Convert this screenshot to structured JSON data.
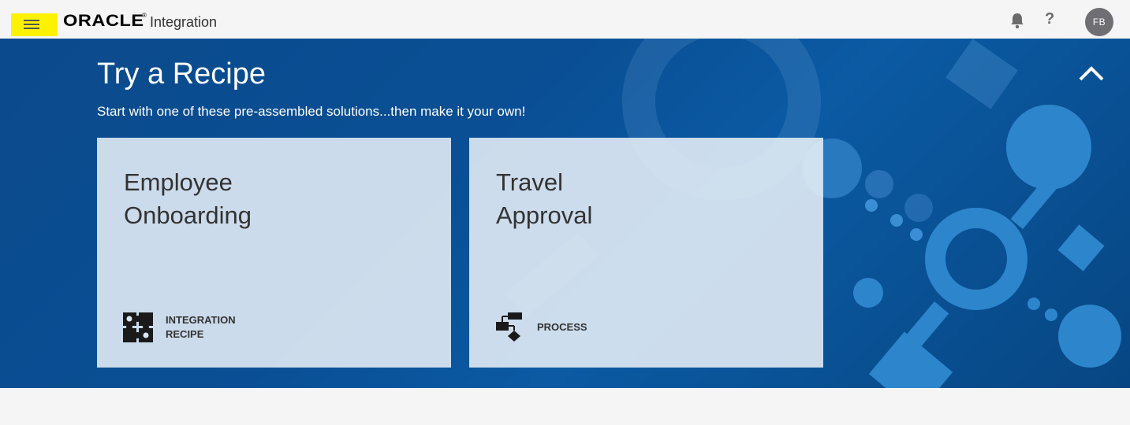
{
  "header": {
    "logo_text": "ORACLE",
    "logo_mark": "®",
    "product_name": "Integration",
    "menu_icon": "hamburger-menu-icon",
    "notifications_icon": "bell-icon",
    "help_icon": "help-icon",
    "help_glyph": "?",
    "user_initials": "FB"
  },
  "hero": {
    "title": "Try a Recipe",
    "subtitle": "Start with one of these pre-assembled solutions...then make it your own!",
    "collapse_icon": "chevron-up-icon"
  },
  "cards": [
    {
      "title_line1": "Employee",
      "title_line2": "Onboarding",
      "type_line1": "INTEGRATION",
      "type_line2": "RECIPE",
      "icon": "puzzle-icon"
    },
    {
      "title_line1": "Travel",
      "title_line2": "Approval",
      "type_line1": "PROCESS",
      "type_line2": "",
      "icon": "process-flow-icon"
    }
  ],
  "colors": {
    "hero_bg": "#0b4f95",
    "menu_highlight": "#fff200",
    "avatar_bg": "#6e6e73"
  }
}
